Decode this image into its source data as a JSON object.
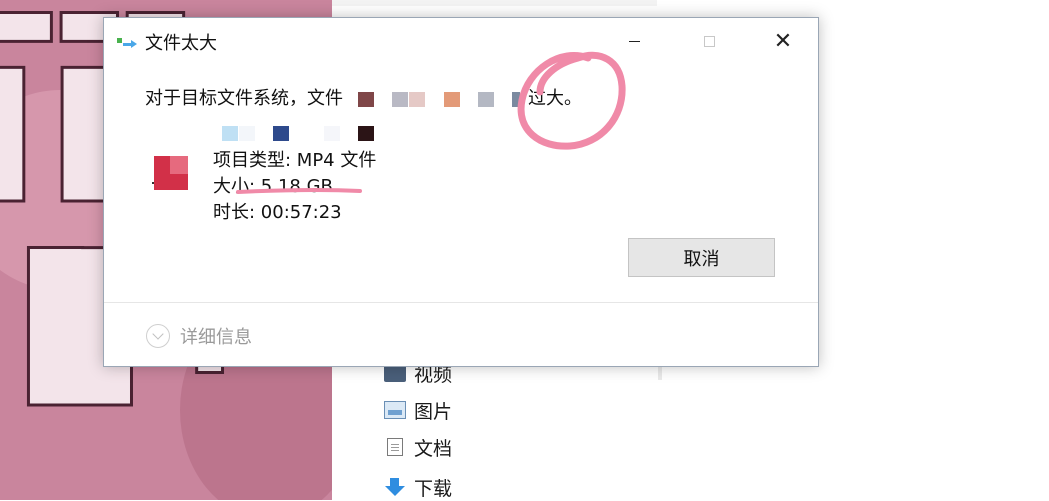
{
  "dialog": {
    "title": "文件太大",
    "message_prefix": "对于目标文件系统，文件",
    "message_suffix": "过大。",
    "item_type": "项目类型: MP4 文件",
    "size": "大小: 5.18 GB",
    "duration": "时长: 00:57:23",
    "cancel_label": "取消",
    "details_label": "详细信息"
  },
  "explorer": {
    "nav_items": [
      {
        "label": "视频",
        "icon": "video-icon"
      },
      {
        "label": "图片",
        "icon": "pictures-icon"
      },
      {
        "label": "文档",
        "icon": "documents-icon"
      },
      {
        "label": "下载",
        "icon": "downloads-icon"
      }
    ]
  },
  "colors": {
    "annotation_pink": "#f08aa8",
    "background_pink": "#c9859d"
  }
}
